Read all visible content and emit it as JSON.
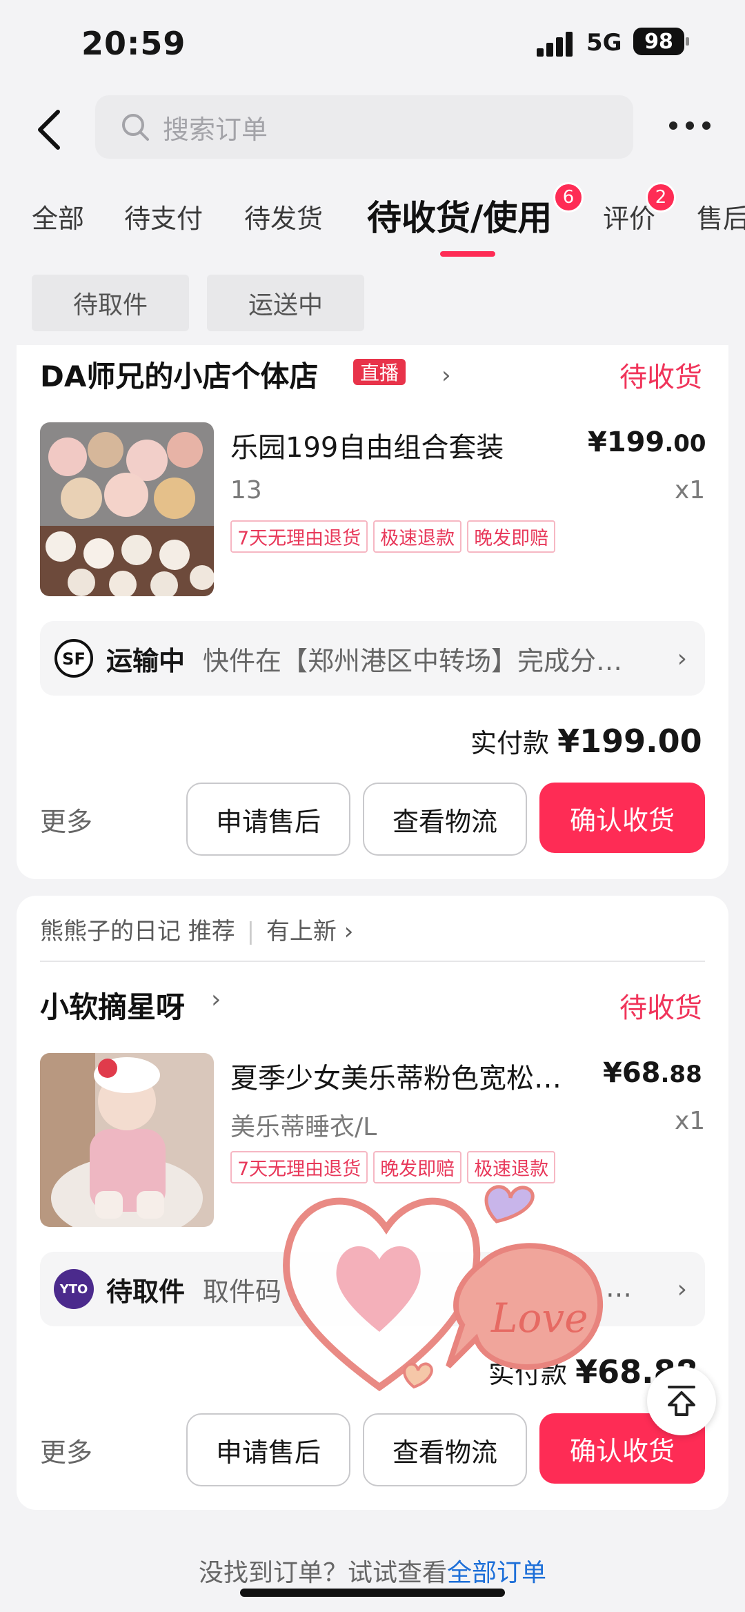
{
  "status_bar": {
    "time": "20:59",
    "network": "5G",
    "battery": "98"
  },
  "header": {
    "search_placeholder": "搜索订单"
  },
  "tabs": [
    {
      "label": "全部"
    },
    {
      "label": "待支付"
    },
    {
      "label": "待发货"
    },
    {
      "label": "待收货/使用",
      "badge": "6",
      "active": true
    },
    {
      "label": "评价",
      "badge": "2"
    },
    {
      "label": "售后"
    }
  ],
  "chips": [
    "待取件",
    "运送中"
  ],
  "orders": [
    {
      "shop": "DA师兄的小店个体店",
      "live_tag": "直播",
      "status": "待收货",
      "product_title": "乐园199自由组合套装",
      "price_int": "¥199",
      "price_dec": ".00",
      "spec": "13",
      "qty": "x1",
      "tags": [
        "7天无理由退货",
        "极速退款",
        "晚发即赔"
      ],
      "shipping_status": "运输中",
      "shipping_text": "快件在【郑州港区中转场】完成分…",
      "paid_label": "实付款",
      "paid_amount": "¥199.00",
      "more": "更多",
      "btn_after_sale": "申请售后",
      "btn_logistics": "查看物流",
      "btn_confirm": "确认收货"
    },
    {
      "recommend_source": "熊熊子的日记 推荐",
      "recommend_new": "有上新",
      "shop": "小软摘星呀",
      "status": "待收货",
      "product_title": "夏季少女美乐蒂粉色宽松…",
      "price_int": "¥68",
      "price_dec": ".88",
      "spec": "美乐蒂睡衣/L",
      "qty": "x1",
      "tags": [
        "7天无理由退货",
        "晚发即赔",
        "极速退款"
      ],
      "courier_logo": "YTO",
      "shipping_status": "待取件",
      "shipping_text": "取件码",
      "shipping_tail": "…",
      "paid_label": "实付款",
      "paid_amount": "¥68.88",
      "more": "更多",
      "btn_after_sale": "申请售后",
      "btn_logistics": "查看物流",
      "btn_confirm": "确认收货",
      "sticker_text": "Love"
    }
  ],
  "footer": {
    "text": "没找到订单？试试查看",
    "link": "全部订单"
  },
  "colors": {
    "accent": "#fe2c55",
    "status_red": "#f0345a",
    "link": "#1d6fd8"
  }
}
